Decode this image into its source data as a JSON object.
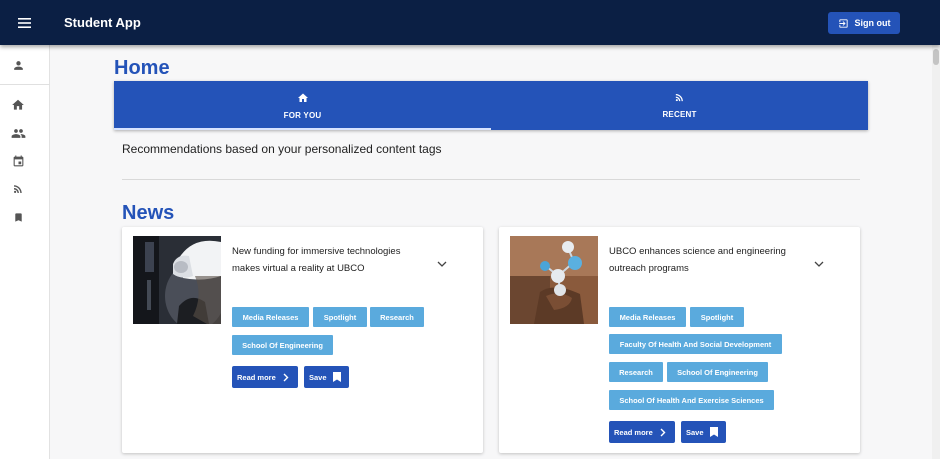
{
  "app": {
    "title": "Student App",
    "sign_out_label": "Sign out"
  },
  "sidebar": {
    "items": [
      {
        "name": "profile",
        "icon": "person-icon"
      },
      {
        "name": "home",
        "icon": "home-icon"
      },
      {
        "name": "people",
        "icon": "people-icon"
      },
      {
        "name": "events",
        "icon": "calendar-icon"
      },
      {
        "name": "feed",
        "icon": "rss-icon"
      },
      {
        "name": "saved",
        "icon": "bookmark-icon"
      }
    ]
  },
  "main": {
    "title": "Home",
    "tabs": [
      {
        "label": "FOR YOU",
        "icon": "home-icon",
        "active": true
      },
      {
        "label": "RECENT",
        "icon": "rss-icon",
        "active": false
      }
    ],
    "recommendation_text": "Recommendations based on your personalized content tags",
    "news_heading": "News"
  },
  "news": [
    {
      "title": "New funding for immersive technologies makes virtual a reality at UBCO",
      "tags": [
        "Media Releases",
        "Spotlight",
        "Research",
        "School Of Engineering"
      ],
      "read_more_label": "Read more",
      "save_label": "Save"
    },
    {
      "title": "UBCO enhances science and engineering outreach programs",
      "tags": [
        "Media Releases",
        "Spotlight",
        "Faculty Of Health And Social Development",
        "Research",
        "School Of Engineering",
        "School Of Health And Exercise Sciences"
      ],
      "read_more_label": "Read more",
      "save_label": "Save"
    }
  ],
  "colors": {
    "appbar": "#0b1f44",
    "primary": "#2453b8",
    "chip": "#5aaadd"
  }
}
